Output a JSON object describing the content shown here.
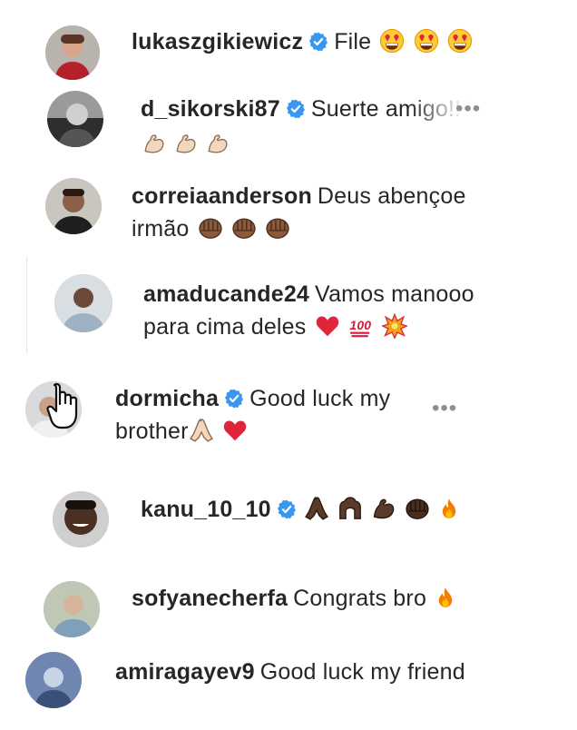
{
  "comments": [
    {
      "username": "lukaszgikiewicz",
      "verified": true,
      "text": "File",
      "emoji": [
        "heart-eyes",
        "heart-eyes",
        "heart-eyes"
      ]
    },
    {
      "username": "d_sikorski87",
      "verified": true,
      "text": "Suerte amigo!!!",
      "emoji": [
        "flexed-biceps",
        "flexed-biceps",
        "flexed-biceps"
      ]
    },
    {
      "username": "correiaanderson",
      "verified": false,
      "text": "Deus abençoe",
      "text2": "irmão",
      "emoji": [
        "fist",
        "fist",
        "fist"
      ]
    },
    {
      "username": "amaducande24",
      "verified": false,
      "text": "Vamos manooo",
      "text2": "para cima deles",
      "emoji": [
        "red-heart",
        "hundred-points",
        "collision"
      ]
    },
    {
      "username": "dormicha",
      "verified": true,
      "text": "Good luck my",
      "text2": "brother",
      "emoji": [
        "folded-hands",
        "red-heart"
      ]
    },
    {
      "username": "kanu_10_10",
      "verified": true,
      "text": "",
      "emoji": [
        "folded-hands",
        "raised-hands",
        "flexed-biceps",
        "fist",
        "fire"
      ]
    },
    {
      "username": "sofyanecherfa",
      "verified": false,
      "text": "Congrats bro",
      "emoji": [
        "fire"
      ]
    },
    {
      "username": "amiragayev9",
      "verified": false,
      "text": "Good luck my friend",
      "emoji": []
    }
  ],
  "more_options": "•••",
  "colors": {
    "verified": "#3897f0",
    "text": "#262626",
    "muted": "#8e8e8e"
  }
}
